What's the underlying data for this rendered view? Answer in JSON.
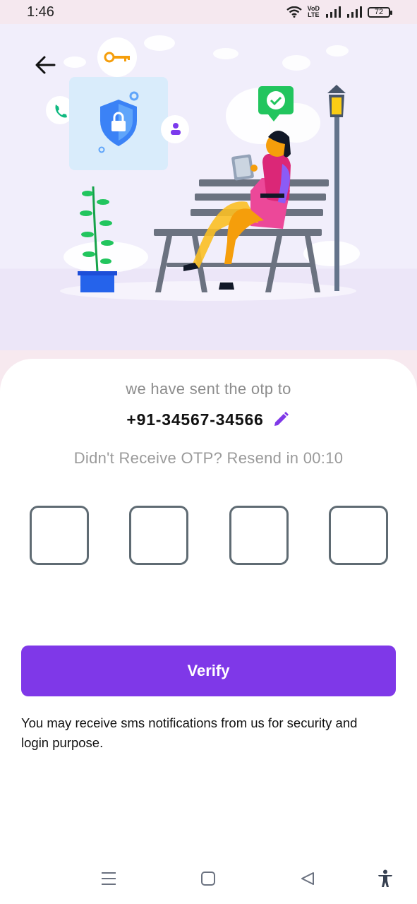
{
  "status_bar": {
    "time": "1:46",
    "network_label_top": "VoD",
    "network_label_bottom": "LTE",
    "battery": "72"
  },
  "otp": {
    "sent_message": "we have sent the otp to",
    "phone_number": "+91-34567-34566",
    "resend_message": "Didn't Receive OTP? Resend in 00:10",
    "boxes": [
      "",
      "",
      "",
      ""
    ]
  },
  "actions": {
    "verify_label": "Verify"
  },
  "notice": "You may receive sms notifications from us for security and login purpose.",
  "icons": {
    "back": "arrow-left-icon",
    "edit": "pencil-icon",
    "menu": "menu-icon",
    "home": "home-square-icon",
    "back_nav": "triangle-back-icon",
    "accessibility": "accessibility-icon"
  },
  "colors": {
    "accent": "#7f38e8",
    "otp_border": "#5f6b73",
    "muted_text": "#8c8c8c"
  }
}
